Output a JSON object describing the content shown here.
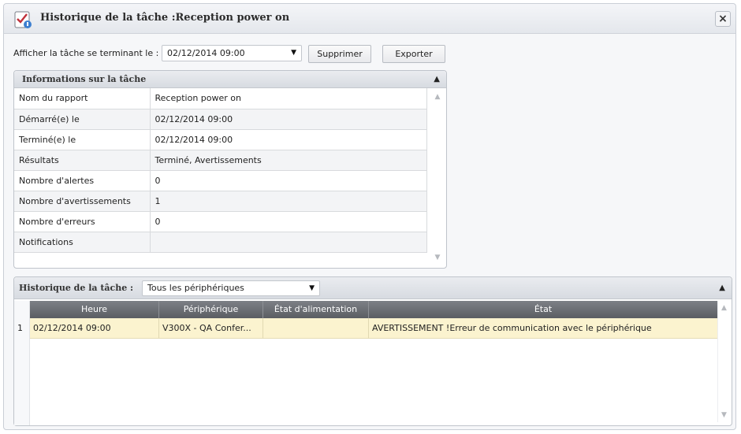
{
  "window": {
    "title": "Historique de la tâche :Reception power on",
    "close_glyph": "×"
  },
  "toolbar": {
    "filter_label": "Afficher la tâche se terminant le :",
    "date_value": "02/12/2014 09:00",
    "delete_label": "Supprimer",
    "export_label": "Exporter"
  },
  "info_panel": {
    "title": "Informations sur la tâche",
    "rows": [
      {
        "key": "Nom du rapport",
        "value": "Reception power on"
      },
      {
        "key": "Démarré(e) le",
        "value": "02/12/2014 09:00"
      },
      {
        "key": "Terminé(e) le",
        "value": "02/12/2014 09:00"
      },
      {
        "key": "Résultats",
        "value": "Terminé, Avertissements"
      },
      {
        "key": "Nombre d'alertes",
        "value": "0"
      },
      {
        "key": "Nombre d'avertissements",
        "value": "1"
      },
      {
        "key": "Nombre d'erreurs",
        "value": "0"
      },
      {
        "key": "Notifications",
        "value": ""
      }
    ]
  },
  "history_panel": {
    "title": "Historique de la tâche :",
    "device_filter": "Tous les périphériques",
    "columns": [
      "Heure",
      "Périphérique",
      "État d'alimentation",
      "État"
    ],
    "rows": [
      {
        "num": "1",
        "time": "02/12/2014 09:00",
        "device": "V300X - QA Confer...",
        "power_state": "",
        "state": "AVERTISSEMENT !Erreur de communication avec le périphérique"
      }
    ]
  },
  "icons": {
    "app": "task-checklist-icon",
    "collapse": "collapse-up-icon",
    "dropdown": "chevron-down-icon"
  },
  "colors": {
    "grid_header": "#6b6e73",
    "selected_row": "#fbf3cf",
    "panel_header": "#dfe2e7"
  }
}
